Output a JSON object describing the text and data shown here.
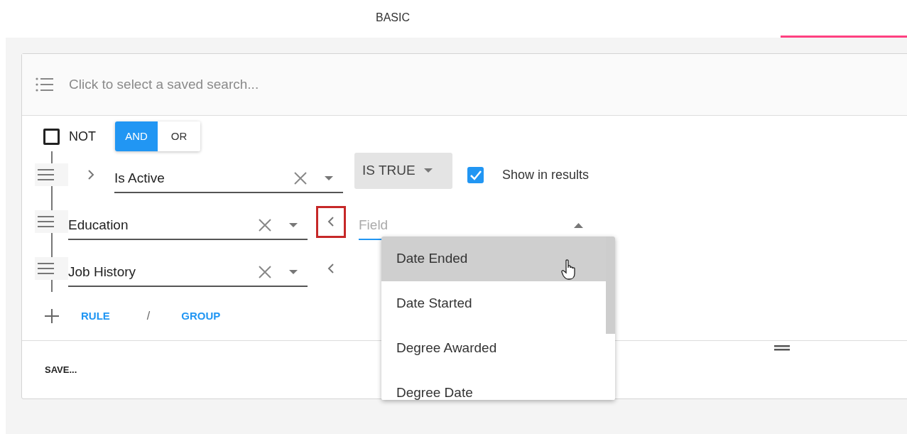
{
  "tabs": [
    {
      "label": "BASIC",
      "selected": false
    },
    {
      "selected": true
    }
  ],
  "saved_search": {
    "placeholder": "Click to select a saved search..."
  },
  "group": {
    "not": {
      "label": "NOT",
      "checked": false
    },
    "conjunctions": [
      {
        "label": "AND",
        "selected": true
      },
      {
        "label": "OR",
        "selected": false
      }
    ],
    "rules": [
      {
        "kind": "rule",
        "field": "Is Active",
        "operator": "IS TRUE",
        "show_in_results": {
          "label": "Show in results",
          "checked": true
        }
      },
      {
        "kind": "group",
        "field": "Education",
        "highlighted": true,
        "subfield": {
          "placeholder": "Field",
          "options": [
            {
              "label": "Date Ended",
              "selected": true
            },
            {
              "label": "Date Started",
              "selected": false
            },
            {
              "label": "Degree Awarded",
              "selected": false
            },
            {
              "label": "Degree Date",
              "selected": false
            }
          ]
        }
      },
      {
        "kind": "group",
        "field": "Job History",
        "highlighted": false
      }
    ],
    "add": {
      "rule": "RULE",
      "separator": "/",
      "group": "GROUP"
    }
  },
  "footer": {
    "save": "SAVE..."
  }
}
